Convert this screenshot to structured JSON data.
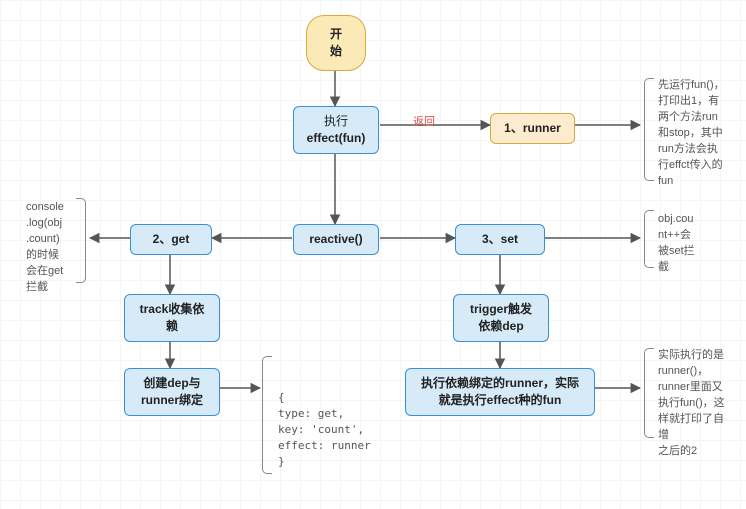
{
  "chart_data": {
    "type": "flowchart",
    "title": "Vue3 reactive/effect 流程图",
    "nodes": [
      {
        "id": "start",
        "label": "开始",
        "kind": "terminator"
      },
      {
        "id": "effect",
        "label": "执行\neffect(fun)",
        "kind": "process"
      },
      {
        "id": "runner",
        "label": "1、runner",
        "kind": "result"
      },
      {
        "id": "reactive",
        "label": "reactive()",
        "kind": "process"
      },
      {
        "id": "get",
        "label": "2、get",
        "kind": "process"
      },
      {
        "id": "set",
        "label": "3、set",
        "kind": "process"
      },
      {
        "id": "track",
        "label": "track收集依\n赖",
        "kind": "process"
      },
      {
        "id": "trigger",
        "label": "trigger触发\n依赖dep",
        "kind": "process"
      },
      {
        "id": "depbind",
        "label": "创建dep与\nrunner绑定",
        "kind": "process"
      },
      {
        "id": "execdep",
        "label": "执行依赖绑定的runner，实际\n就是执行effect种的fun",
        "kind": "process"
      }
    ],
    "edges": [
      {
        "from": "start",
        "to": "effect"
      },
      {
        "from": "effect",
        "to": "runner",
        "label": "返回"
      },
      {
        "from": "effect",
        "to": "reactive"
      },
      {
        "from": "reactive",
        "to": "get"
      },
      {
        "from": "reactive",
        "to": "set"
      },
      {
        "from": "get",
        "to": "track"
      },
      {
        "from": "set",
        "to": "trigger"
      },
      {
        "from": "track",
        "to": "depbind"
      },
      {
        "from": "trigger",
        "to": "execdep"
      }
    ],
    "annotations": [
      {
        "target": "runner",
        "text": "先运行fun()，打印出1，有两个方法run和stop，其中run方法会执行effct传入的fun"
      },
      {
        "target": "get",
        "text": "console.log(obj.count)的时候会在get拦截"
      },
      {
        "target": "set",
        "text": "obj.count++会被set拦截"
      },
      {
        "target": "depbind",
        "text": "{ type: get, key: 'count', effect: runner }"
      },
      {
        "target": "execdep",
        "text": "实际执行的是runner()，runner里面又执行fun()，这样就打印了自增之后的2"
      }
    ]
  },
  "labels": {
    "return": "返回"
  },
  "notes": {
    "runner": "先运行fun()，\n打印出1，有\n两个方法run\n和stop，其中\nrun方法会执\n行effct传入的\nfun",
    "get": "console\n.log(obj\n.count)\n的时候\n会在get\n拦截",
    "set": "obj.cou\nnt++会\n被set拦\n截",
    "depbind": "{\n  type: get,\n  key: 'count',\n  effect: runner\n}",
    "execdep": "实际执行的是\nrunner()，\nrunner里面又\n执行fun()，这\n样就打印了自增\n之后的2"
  },
  "box": {
    "start": "开始",
    "effect1": "执行",
    "effect2": "effect(fun)",
    "runner": "1、runner",
    "reactive": "reactive()",
    "get": "2、get",
    "set": "3、set",
    "track1": "track收集依",
    "track2": "赖",
    "trigger1": "trigger触发",
    "trigger2": "依赖dep",
    "dep1": "创建dep与",
    "dep2": "runner绑定",
    "exec1": "执行依赖绑定的runner，实际",
    "exec2": "就是执行effect种的fun"
  }
}
